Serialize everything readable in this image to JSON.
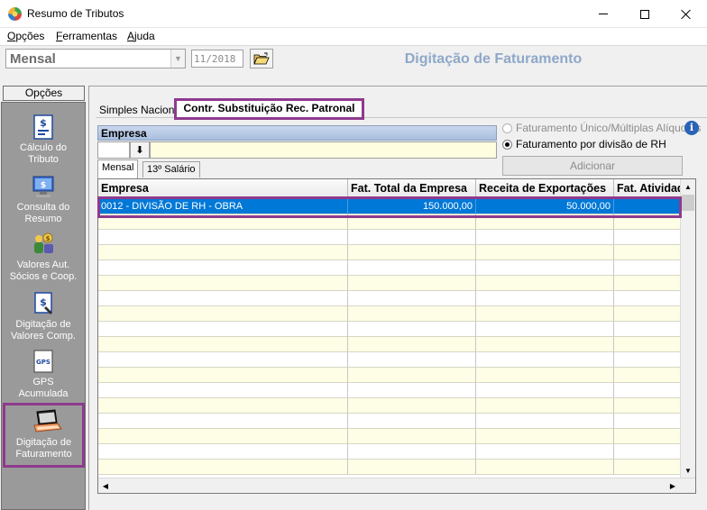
{
  "window": {
    "title": "Resumo de Tributos"
  },
  "menu": [
    {
      "label": "Opções",
      "accel": "O",
      "rest": "pções"
    },
    {
      "label": "Ferramentas",
      "accel": "F",
      "rest": "erramentas"
    },
    {
      "label": "Ajuda",
      "accel": "A",
      "rest": "juda"
    }
  ],
  "toolbar": {
    "period": "Mensal",
    "date": "11/2018",
    "header_title": "Digitação de Faturamento"
  },
  "sidebar": {
    "label": "Opções",
    "items": [
      {
        "label_line1": "Cálculo do",
        "label_line2": "Tributo",
        "icon": "calculator-document-icon"
      },
      {
        "label_line1": "Consulta do",
        "label_line2": "Resumo",
        "icon": "monitor-search-icon"
      },
      {
        "label_line1": "Valores Aut.",
        "label_line2": "Sócios e  Coop.",
        "icon": "people-money-icon"
      },
      {
        "label_line1": "Digitação de",
        "label_line2": "Valores Comp.",
        "icon": "money-document-icon"
      },
      {
        "label_line1": "GPS",
        "label_line2": "Acumulada",
        "icon": "gps-document-icon"
      },
      {
        "label_line1": "Digitação de",
        "label_line2": "Faturamento",
        "icon": "laptop-icon"
      }
    ]
  },
  "tabs": {
    "simples": "Simples Nacional",
    "contr": "Contr. Substituição Rec. Patronal"
  },
  "empresa": {
    "header": "Empresa",
    "lookup_symbol": "⬇"
  },
  "options": {
    "unico": "Faturamento Único/Múltiplas Alíquotas",
    "divisao": "Faturamento por divisão de RH",
    "selected": "divisao",
    "add_button": "Adicionar"
  },
  "subtabs": [
    "Mensal",
    "13º Salário"
  ],
  "grid": {
    "columns": [
      "Empresa",
      "Fat. Total da Empresa",
      "Receita de Exportações",
      "Fat. Atividad"
    ],
    "rows": [
      [
        "0012 - DIVISÃO DE RH - OBRA",
        "150.000,00",
        "50.000,00",
        ""
      ]
    ]
  },
  "colors": {
    "accent": "#0078d7",
    "highlight_outline": "#8e3a8e",
    "header_title": "#8ea8c8"
  }
}
